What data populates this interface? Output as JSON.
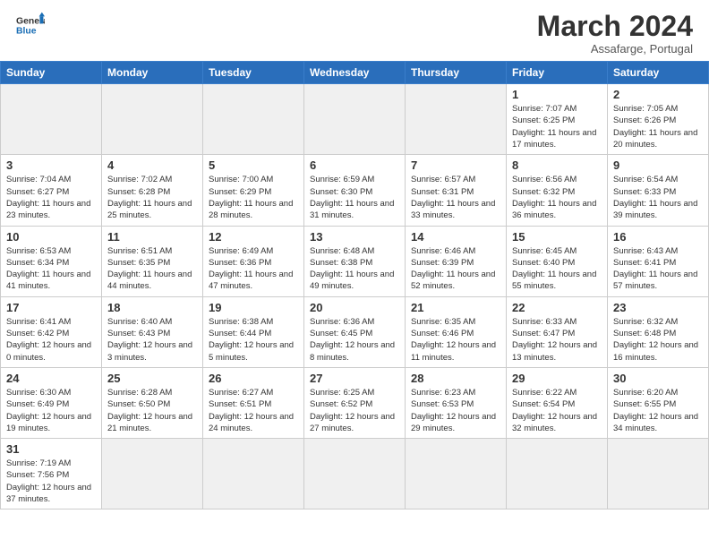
{
  "header": {
    "logo_general": "General",
    "logo_blue": "Blue",
    "month": "March 2024",
    "location": "Assafarge, Portugal"
  },
  "weekdays": [
    "Sunday",
    "Monday",
    "Tuesday",
    "Wednesday",
    "Thursday",
    "Friday",
    "Saturday"
  ],
  "days": {
    "1": {
      "sunrise": "7:07 AM",
      "sunset": "6:25 PM",
      "daylight": "11 hours and 17 minutes."
    },
    "2": {
      "sunrise": "7:05 AM",
      "sunset": "6:26 PM",
      "daylight": "11 hours and 20 minutes."
    },
    "3": {
      "sunrise": "7:04 AM",
      "sunset": "6:27 PM",
      "daylight": "11 hours and 23 minutes."
    },
    "4": {
      "sunrise": "7:02 AM",
      "sunset": "6:28 PM",
      "daylight": "11 hours and 25 minutes."
    },
    "5": {
      "sunrise": "7:00 AM",
      "sunset": "6:29 PM",
      "daylight": "11 hours and 28 minutes."
    },
    "6": {
      "sunrise": "6:59 AM",
      "sunset": "6:30 PM",
      "daylight": "11 hours and 31 minutes."
    },
    "7": {
      "sunrise": "6:57 AM",
      "sunset": "6:31 PM",
      "daylight": "11 hours and 33 minutes."
    },
    "8": {
      "sunrise": "6:56 AM",
      "sunset": "6:32 PM",
      "daylight": "11 hours and 36 minutes."
    },
    "9": {
      "sunrise": "6:54 AM",
      "sunset": "6:33 PM",
      "daylight": "11 hours and 39 minutes."
    },
    "10": {
      "sunrise": "6:53 AM",
      "sunset": "6:34 PM",
      "daylight": "11 hours and 41 minutes."
    },
    "11": {
      "sunrise": "6:51 AM",
      "sunset": "6:35 PM",
      "daylight": "11 hours and 44 minutes."
    },
    "12": {
      "sunrise": "6:49 AM",
      "sunset": "6:36 PM",
      "daylight": "11 hours and 47 minutes."
    },
    "13": {
      "sunrise": "6:48 AM",
      "sunset": "6:38 PM",
      "daylight": "11 hours and 49 minutes."
    },
    "14": {
      "sunrise": "6:46 AM",
      "sunset": "6:39 PM",
      "daylight": "11 hours and 52 minutes."
    },
    "15": {
      "sunrise": "6:45 AM",
      "sunset": "6:40 PM",
      "daylight": "11 hours and 55 minutes."
    },
    "16": {
      "sunrise": "6:43 AM",
      "sunset": "6:41 PM",
      "daylight": "11 hours and 57 minutes."
    },
    "17": {
      "sunrise": "6:41 AM",
      "sunset": "6:42 PM",
      "daylight": "12 hours and 0 minutes."
    },
    "18": {
      "sunrise": "6:40 AM",
      "sunset": "6:43 PM",
      "daylight": "12 hours and 3 minutes."
    },
    "19": {
      "sunrise": "6:38 AM",
      "sunset": "6:44 PM",
      "daylight": "12 hours and 5 minutes."
    },
    "20": {
      "sunrise": "6:36 AM",
      "sunset": "6:45 PM",
      "daylight": "12 hours and 8 minutes."
    },
    "21": {
      "sunrise": "6:35 AM",
      "sunset": "6:46 PM",
      "daylight": "12 hours and 11 minutes."
    },
    "22": {
      "sunrise": "6:33 AM",
      "sunset": "6:47 PM",
      "daylight": "12 hours and 13 minutes."
    },
    "23": {
      "sunrise": "6:32 AM",
      "sunset": "6:48 PM",
      "daylight": "12 hours and 16 minutes."
    },
    "24": {
      "sunrise": "6:30 AM",
      "sunset": "6:49 PM",
      "daylight": "12 hours and 19 minutes."
    },
    "25": {
      "sunrise": "6:28 AM",
      "sunset": "6:50 PM",
      "daylight": "12 hours and 21 minutes."
    },
    "26": {
      "sunrise": "6:27 AM",
      "sunset": "6:51 PM",
      "daylight": "12 hours and 24 minutes."
    },
    "27": {
      "sunrise": "6:25 AM",
      "sunset": "6:52 PM",
      "daylight": "12 hours and 27 minutes."
    },
    "28": {
      "sunrise": "6:23 AM",
      "sunset": "6:53 PM",
      "daylight": "12 hours and 29 minutes."
    },
    "29": {
      "sunrise": "6:22 AM",
      "sunset": "6:54 PM",
      "daylight": "12 hours and 32 minutes."
    },
    "30": {
      "sunrise": "6:20 AM",
      "sunset": "6:55 PM",
      "daylight": "12 hours and 34 minutes."
    },
    "31": {
      "sunrise": "7:19 AM",
      "sunset": "7:56 PM",
      "daylight": "12 hours and 37 minutes."
    }
  },
  "labels": {
    "sunrise": "Sunrise:",
    "sunset": "Sunset:",
    "daylight": "Daylight:"
  }
}
